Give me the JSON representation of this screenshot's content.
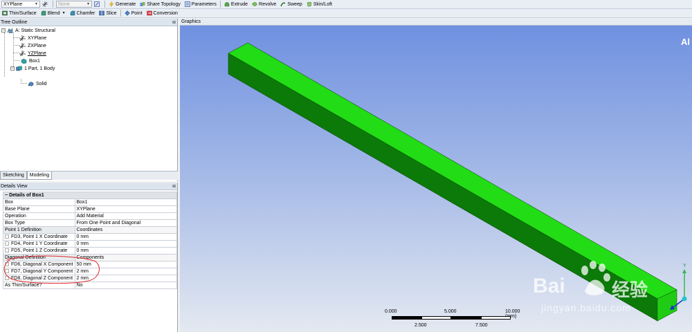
{
  "toolbar1": {
    "plane_select": "XYPlane",
    "sketch_select": "None",
    "generate": "Generate",
    "share_topology": "Share Topology",
    "parameters": "Parameters",
    "extrude": "Extrude",
    "revolve": "Revolve",
    "sweep": "Sweep",
    "skin_loft": "Skin/Loft"
  },
  "toolbar2": {
    "thin_surface": "Thin/Surface",
    "blend": "Blend",
    "chamfer": "Chamfer",
    "slice": "Slice",
    "point": "Point",
    "conversion": "Conversion"
  },
  "tree_outline": {
    "title": "Tree Outline",
    "root": "A: Static Structural",
    "nodes": [
      "XYPlane",
      "ZXPlane",
      "YZPlane",
      "Box1",
      "1 Part, 1 Body",
      "Solid"
    ]
  },
  "tabs": [
    "Sketching",
    "Modeling"
  ],
  "details_view": {
    "title": "Details View",
    "section": "Details of Box1",
    "rows": [
      {
        "label": "Box",
        "value": "Box1"
      },
      {
        "label": "Base Plane",
        "value": "XYPlane"
      },
      {
        "label": "Operation",
        "value": "Add Material"
      },
      {
        "label": "Box Type",
        "value": "From One Point and Diagonal"
      },
      {
        "label": "Point 1 Definition",
        "value": "Coordinates"
      },
      {
        "label": "FD3, Point 1 X Coordinate",
        "value": "0 mm"
      },
      {
        "label": "FD4, Point 1 Y Coordinate",
        "value": "0 mm"
      },
      {
        "label": "FD5, Point 1 Z Coordinate",
        "value": "0 mm"
      },
      {
        "label": "Diagonal Definition",
        "value": "Components"
      },
      {
        "label": "FD6, Diagonal X Component",
        "value": "50 mm"
      },
      {
        "label": "FD7, Diagonal Y Component",
        "value": "2 mm"
      },
      {
        "label": "FD8, Diagonal Z Component",
        "value": "2 mm"
      },
      {
        "label": "As Thin/Surface?",
        "value": "No"
      }
    ]
  },
  "graphics": {
    "title": "Graphics",
    "corner_text": "Al",
    "scale": {
      "top_labels": [
        "0.000",
        "5.000",
        "10.000 (mm)"
      ],
      "bottom_labels": [
        "2.500",
        "7.500"
      ]
    },
    "axis_y_label": "Y",
    "watermark": {
      "brand": "Bai",
      "sub": "经验",
      "url": "jingyan.baidu.com"
    }
  },
  "colors": {
    "body_green": "#16d40e",
    "annotation_red": "#e0252a"
  }
}
